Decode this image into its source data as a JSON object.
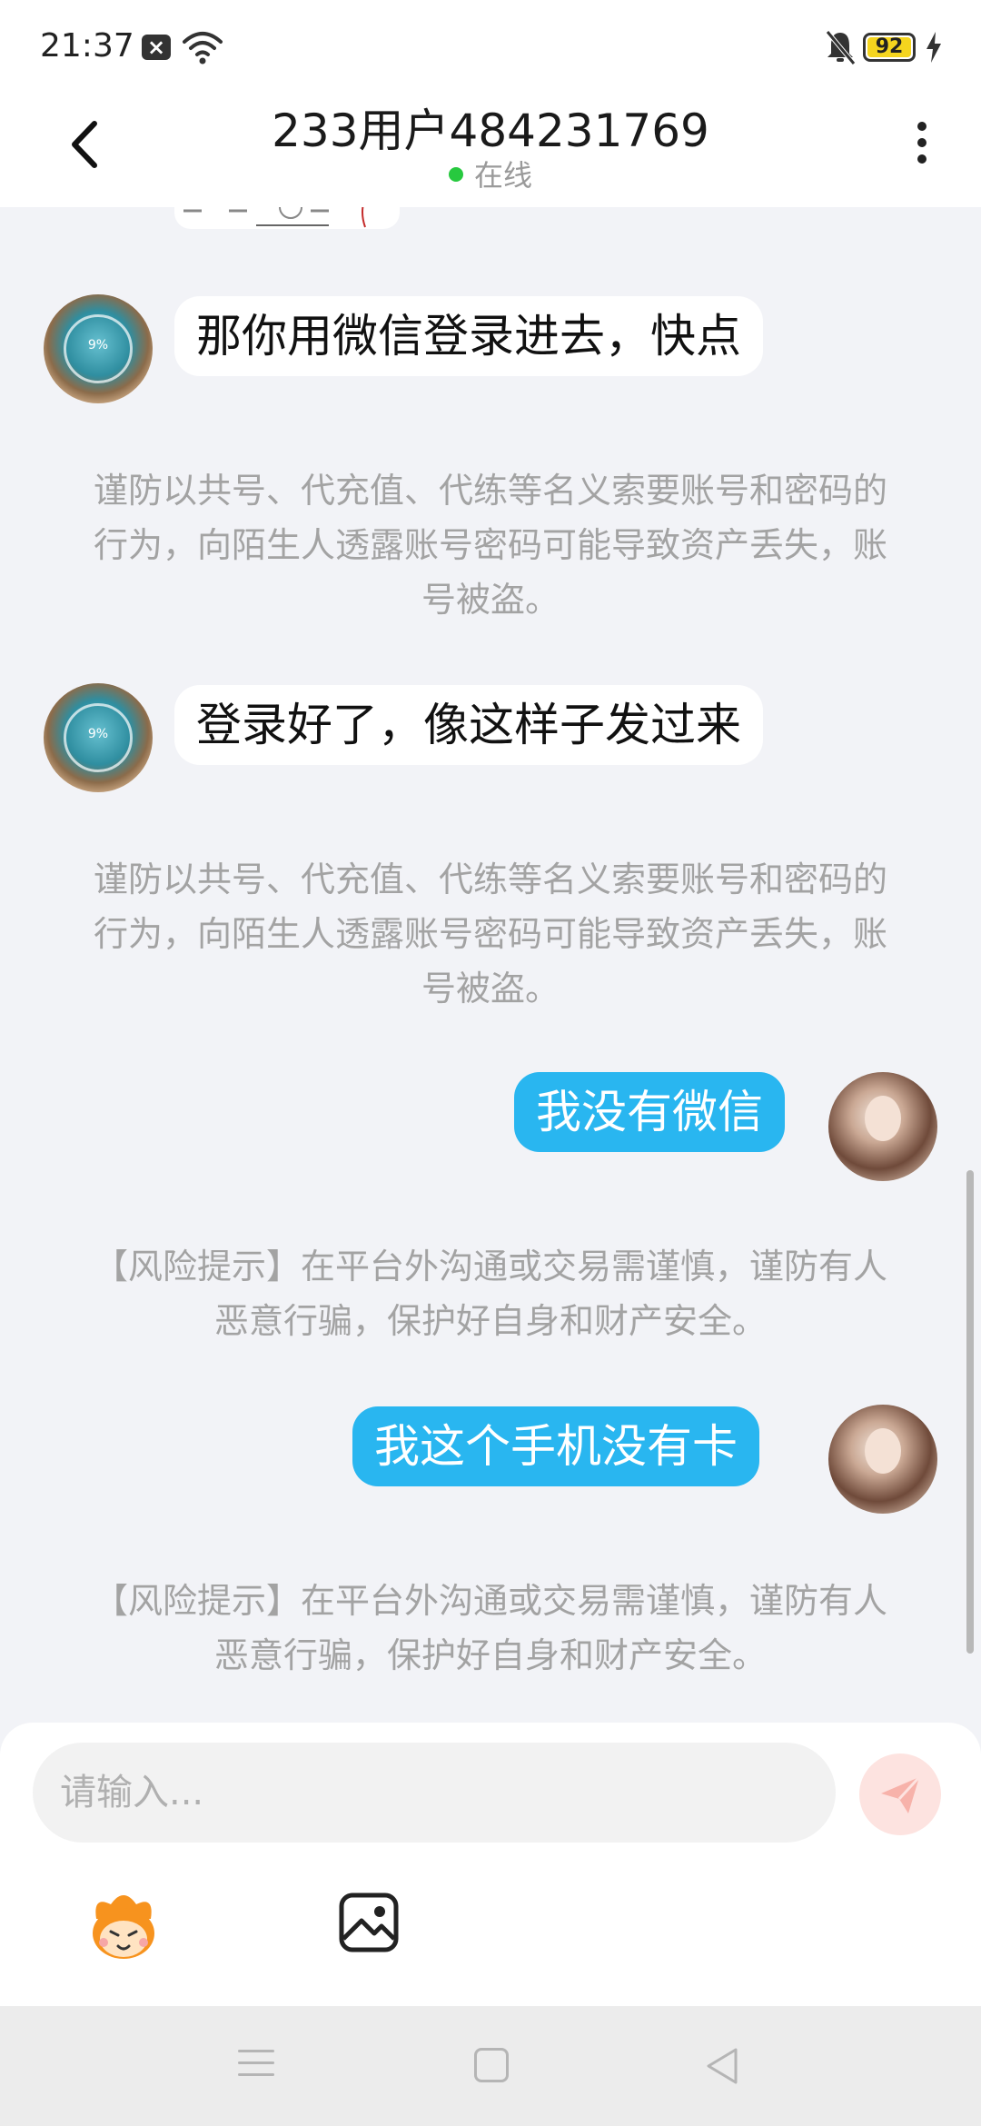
{
  "status_bar": {
    "time": "21:37",
    "battery": "92",
    "icons": [
      "close-notification-icon",
      "wifi-icon",
      "bell-muted-icon",
      "battery-icon",
      "charging-bolt-icon"
    ]
  },
  "header": {
    "title": "233用户484231769",
    "status": "在线",
    "status_color": "#27c93f"
  },
  "messages": [
    {
      "side": "left",
      "text": "那你用微信登录进去，快点",
      "avatar_label": "9%"
    },
    {
      "side": "system",
      "text": "谨防以共号、代充值、代练等名义索要账号和密码的行为，向陌生人透露账号密码可能导致资产丢失，账号被盗。"
    },
    {
      "side": "left",
      "text": "登录好了，像这样子发过来",
      "avatar_label": "9%"
    },
    {
      "side": "system",
      "text": "谨防以共号、代充值、代练等名义索要账号和密码的行为，向陌生人透露账号密码可能导致资产丢失，账号被盗。"
    },
    {
      "side": "right",
      "text": "我没有微信"
    },
    {
      "side": "system",
      "text": "【风险提示】在平台外沟通或交易需谨慎，谨防有人恶意行骗，保护好自身和财产安全。"
    },
    {
      "side": "right",
      "text": "我这个手机没有卡"
    },
    {
      "side": "system",
      "text": "【风险提示】在平台外沟通或交易需谨慎，谨防有人恶意行骗，保护好自身和财产安全。"
    }
  ],
  "composer": {
    "placeholder": "请输入..."
  },
  "colors": {
    "outgoing_bubble": "#29b6f0",
    "incoming_bubble": "#ffffff",
    "background": "#f2f3f7",
    "notice_text": "#a3a3a3"
  }
}
